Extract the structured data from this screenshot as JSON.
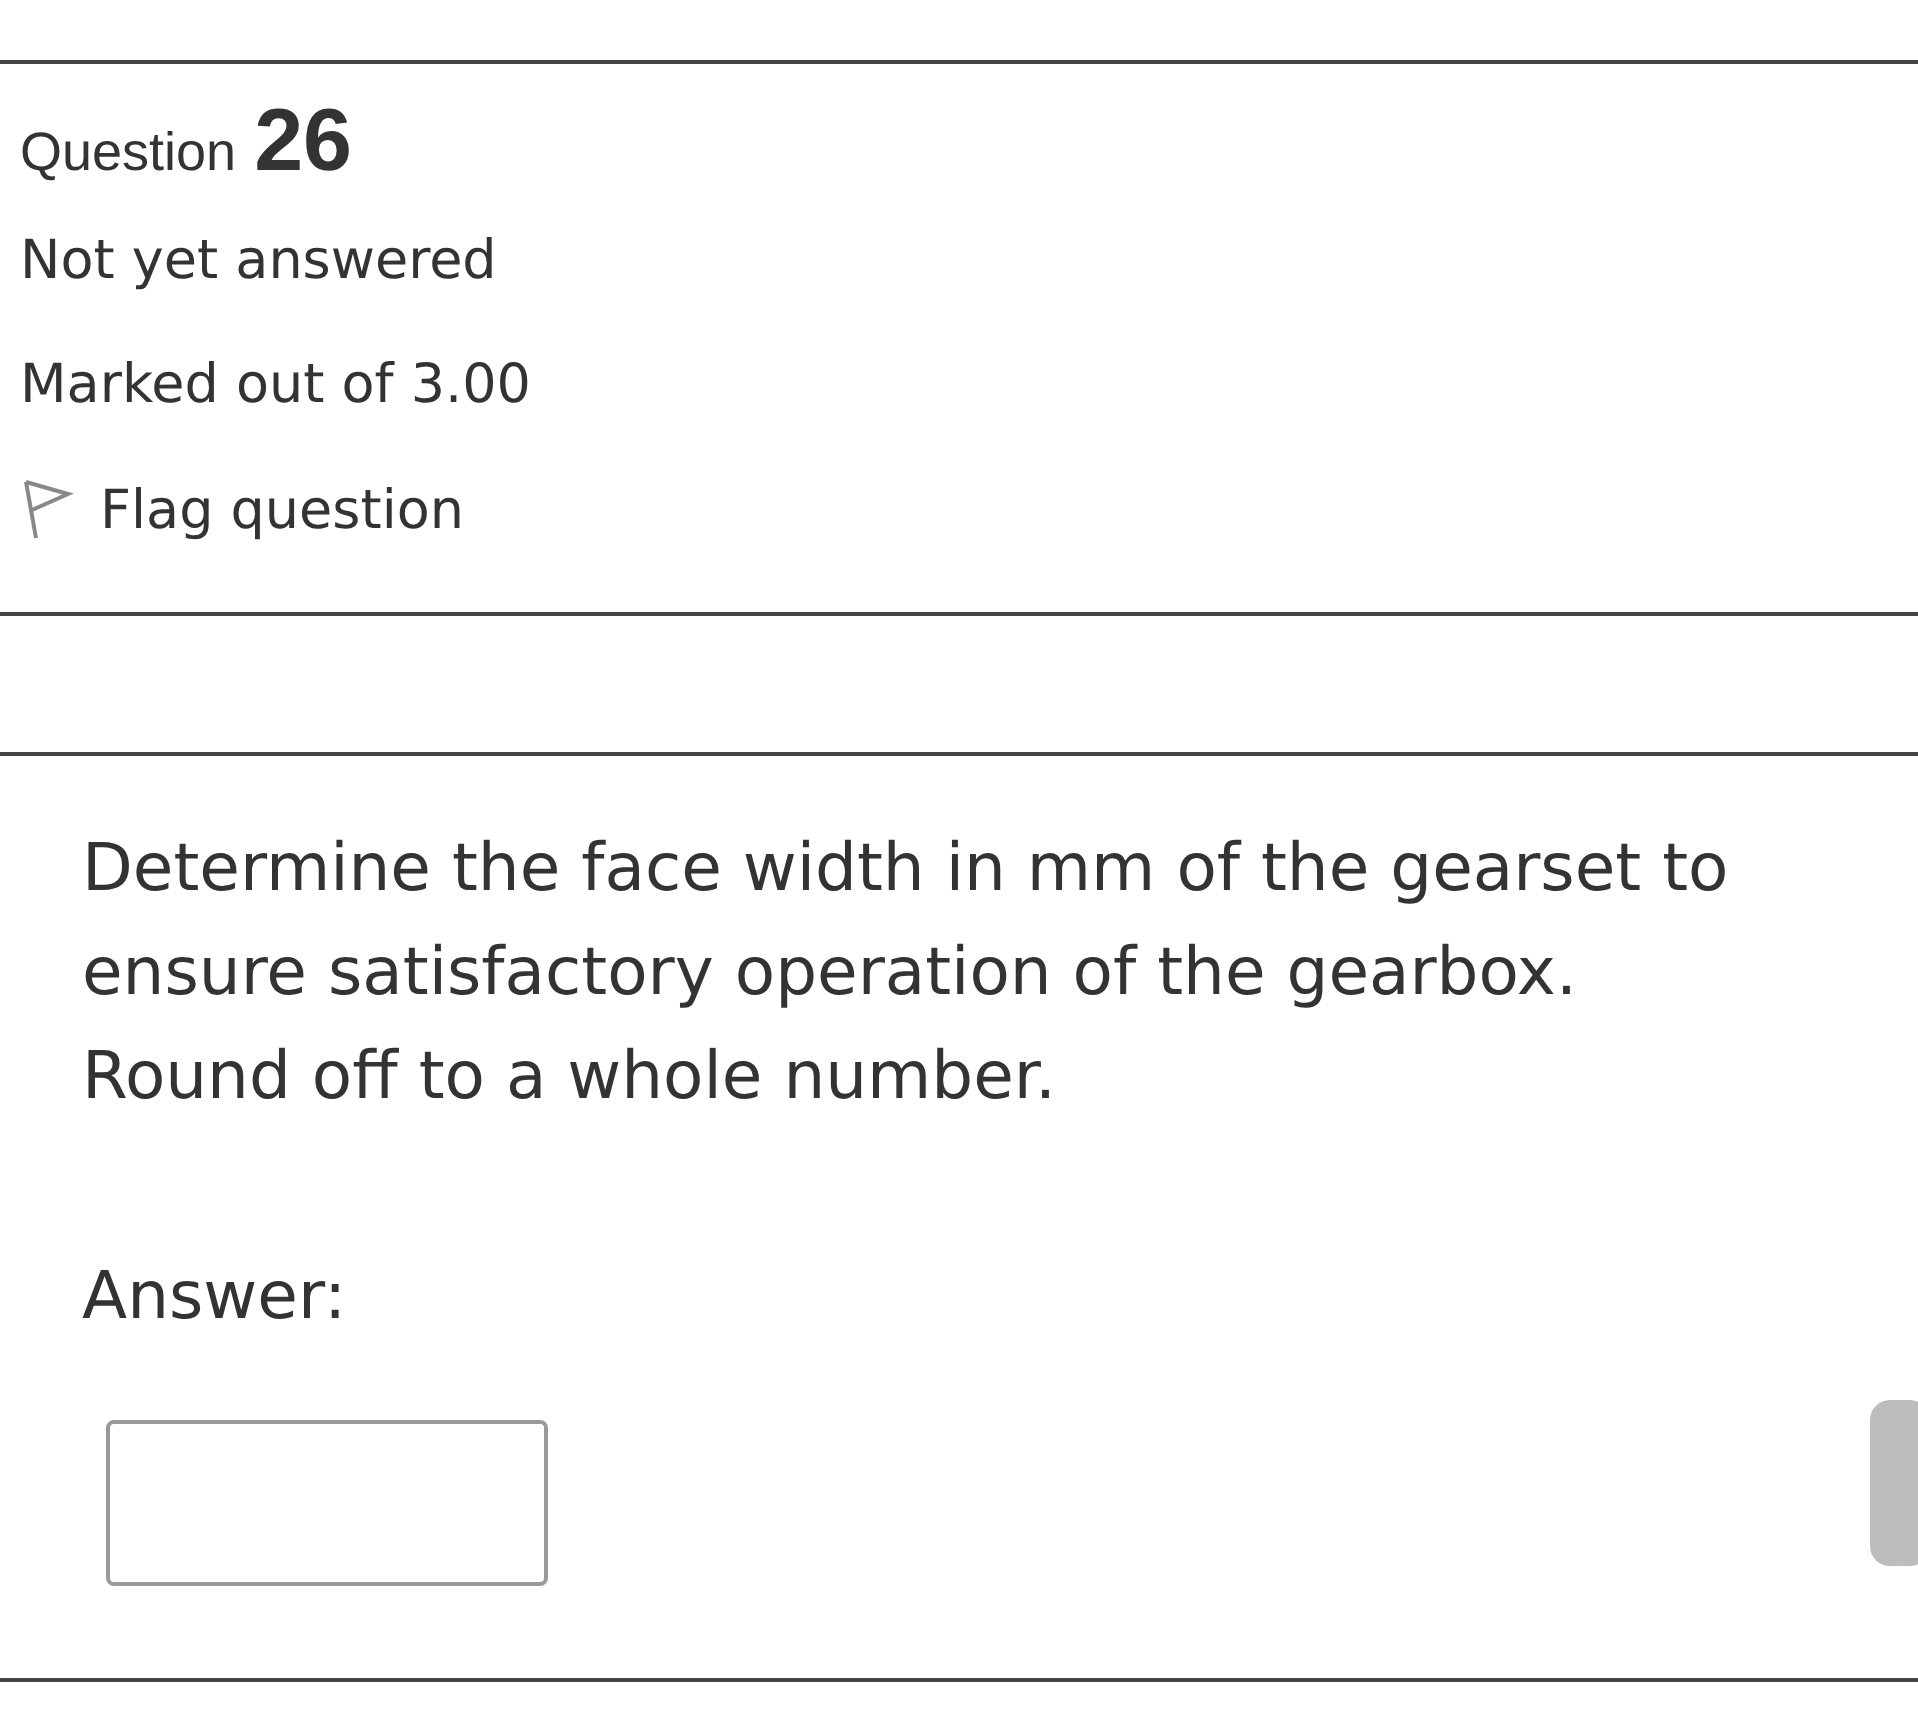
{
  "question": {
    "label": "Question",
    "number": "26",
    "status": "Not yet answered",
    "marks": "Marked out of 3.00",
    "flag": {
      "label": "Flag question",
      "flagged": false
    }
  },
  "prompt": "Determine the face width in mm of the gearset to ensure satisfactory operation of the gearbox. Round off to a whole number.",
  "answer": {
    "label": "Answer:"
  }
}
